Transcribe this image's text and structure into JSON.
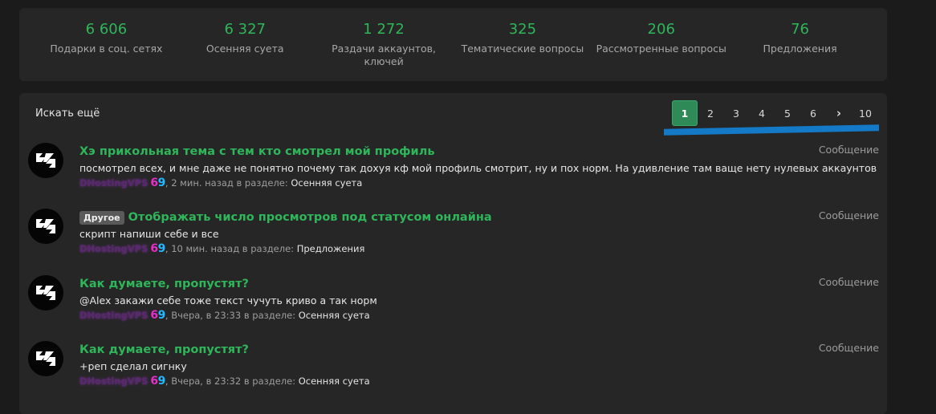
{
  "stats": [
    {
      "num": "6 606",
      "label": "Подарки в соц. сетях"
    },
    {
      "num": "6 327",
      "label": "Осенняя суета"
    },
    {
      "num": "1 272",
      "label": "Раздачи аккаунтов, ключей"
    },
    {
      "num": "325",
      "label": "Тематические вопросы"
    },
    {
      "num": "206",
      "label": "Рассмотренные вопросы"
    },
    {
      "num": "76",
      "label": "Предложения"
    }
  ],
  "search_more": "Искать ещё",
  "pager": {
    "pages": [
      "1",
      "2",
      "3",
      "4",
      "5",
      "6"
    ],
    "next": "›",
    "last": "10"
  },
  "posts": [
    {
      "tag": "",
      "title": "Хэ прикольная тема с тем кто смотрел мой профиль",
      "snippet": "посмотрел всех, и мне даже не понятно почему так дохуя кф мой профиль смотрит, ну и пох норм. На удивление там ваще нету нулевых аккаунтов",
      "author": "DHostingVPS",
      "badge6": "6",
      "badge9": "9",
      "time": ", 2 мин. назад в разделе: ",
      "section": "Осенняя суета",
      "type": "Сообщение"
    },
    {
      "tag": "Другое",
      "title": "Отображать число просмотров под статусом онлайна",
      "snippet": "скрипт напиши себе и все",
      "author": "DHostingVPS",
      "badge6": "6",
      "badge9": "9",
      "time": ", 10 мин. назад в разделе: ",
      "section": "Предложения",
      "type": "Сообщение"
    },
    {
      "tag": "",
      "title": "Как думаете, пропустят?",
      "snippet": "@Alex закажи себе тоже текст чучуть криво а так норм",
      "author": "DHostingVPS",
      "badge6": "6",
      "badge9": "9",
      "time": ", Вчера, в 23:33 в разделе: ",
      "section": "Осенняя суета",
      "type": "Сообщение"
    },
    {
      "tag": "",
      "title": "Как думаете, пропустят?",
      "snippet": "+реп сделал сигнку",
      "author": "DHostingVPS",
      "badge6": "6",
      "badge9": "9",
      "time": ", Вчера, в 23:32 в разделе: ",
      "section": "Осенняя суета",
      "type": "Сообщение"
    }
  ]
}
